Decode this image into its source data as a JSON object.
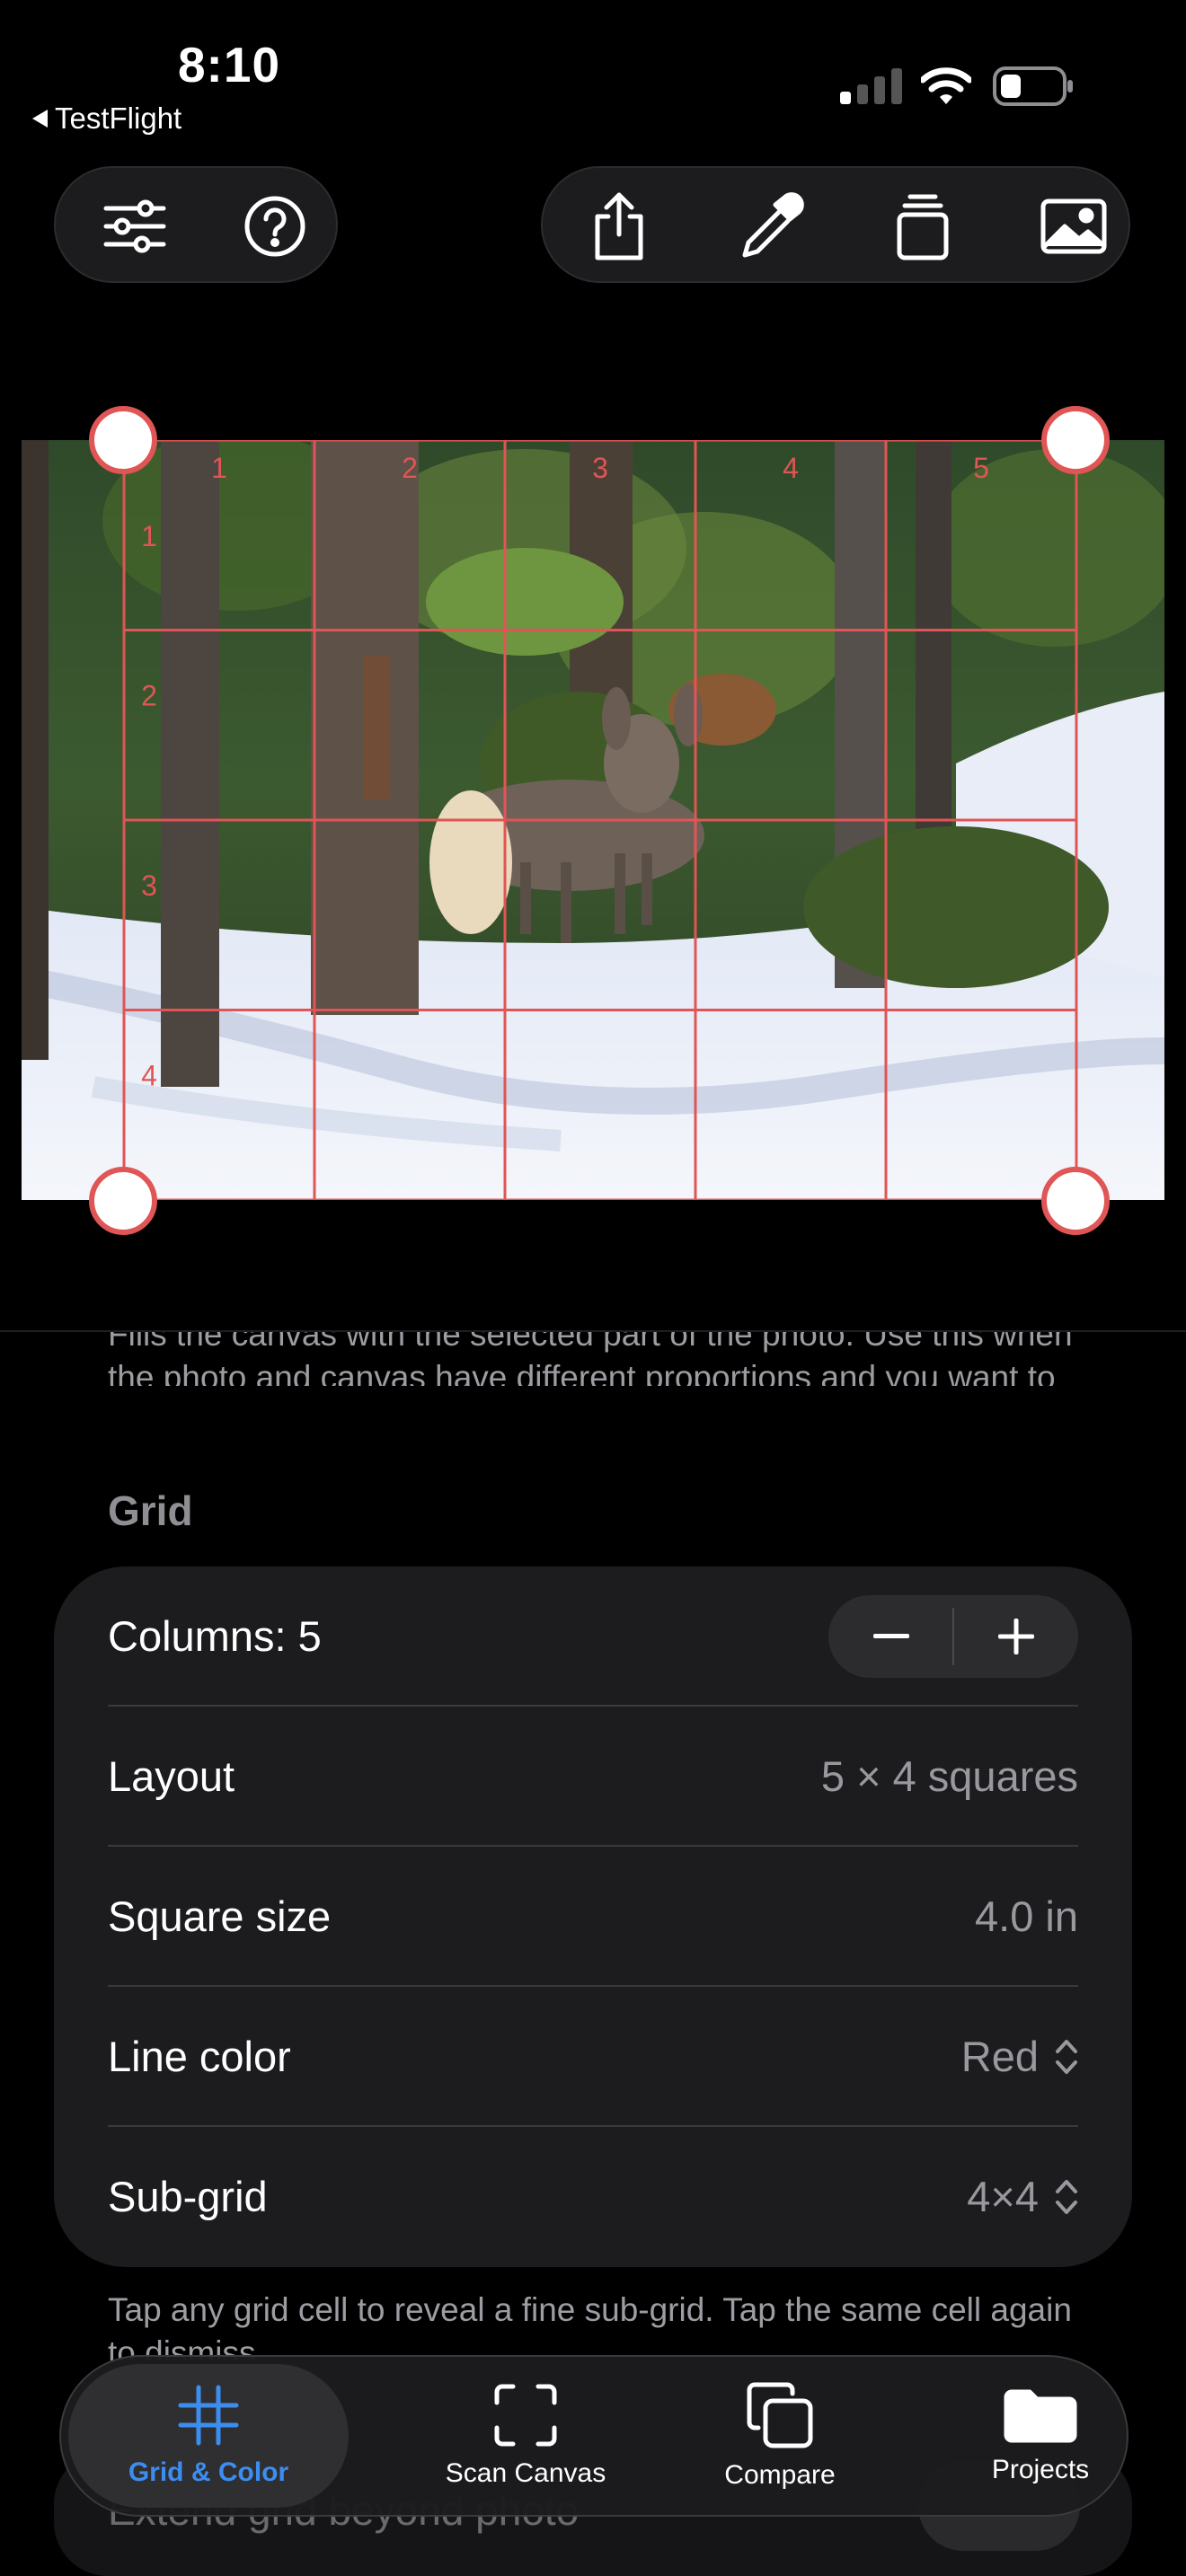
{
  "status_bar": {
    "time": "8:10",
    "back_app": "TestFlight"
  },
  "toolbar_left": {
    "icons": [
      "sliders-icon",
      "help-icon"
    ]
  },
  "toolbar_right": {
    "icons": [
      "share-icon",
      "eyedropper-icon",
      "layers-icon",
      "photo-icon"
    ]
  },
  "grid_overlay": {
    "columns": 5,
    "rows": 4,
    "line_color": "#e05555",
    "column_labels": [
      "1",
      "2",
      "3",
      "4",
      "5"
    ],
    "row_labels": [
      "1",
      "2",
      "3",
      "4"
    ]
  },
  "panel": {
    "description": "Fills the canvas with the selected part of the photo. Use this when the photo and canvas have different proportions and you want to paint a portion of the image.",
    "grid_header": "Grid",
    "columns_label": "Columns: 5",
    "layout_label": "Layout",
    "layout_value": "5 × 4 squares",
    "square_size_label": "Square size",
    "square_size_value": "4.0 in",
    "line_color_label": "Line color",
    "line_color_value": "Red",
    "subgrid_label": "Sub-grid",
    "subgrid_value": "4×4",
    "hint": "Tap any grid cell to reveal a fine sub-grid. Tap the same cell again to dismiss.",
    "extend_label": "Extend grid beyond photo"
  },
  "tabbar": {
    "grid_color": "Grid & Color",
    "scan_canvas": "Scan Canvas",
    "compare": "Compare",
    "projects": "Projects",
    "accent": "#3b8ef0"
  }
}
